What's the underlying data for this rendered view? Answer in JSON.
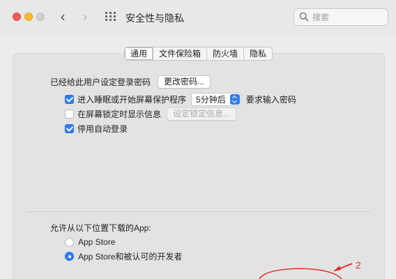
{
  "window": {
    "title": "安全性与隐私",
    "search_placeholder": "搜索"
  },
  "icons": {
    "back": "chevron-left-icon",
    "forward": "chevron-right-icon",
    "grid": "grid-icon",
    "search": "search-icon"
  },
  "tabs": [
    {
      "label": "通用",
      "active": true
    },
    {
      "label": "文件保险箱",
      "active": false
    },
    {
      "label": "防火墙",
      "active": false
    },
    {
      "label": "隐私",
      "active": false
    }
  ],
  "general": {
    "login_password_label": "已经给此用户设定登录密码",
    "change_password_button": "更改密码...",
    "require_password": {
      "checked": true,
      "label_before": "进入睡眠或开始屏幕保护程序",
      "delay_value": "5分钟后",
      "label_after": "要求输入密码"
    },
    "show_message": {
      "checked": false,
      "label": "在屏幕锁定时显示信息",
      "button": "设定锁定信息..."
    },
    "disable_auto_login": {
      "checked": true,
      "label": "停用自动登录"
    }
  },
  "downloads": {
    "heading": "允许从以下位置下载的App:",
    "options": [
      {
        "label": "App Store",
        "selected": false
      },
      {
        "label": "App Store和被认可的开发者",
        "selected": true
      }
    ]
  },
  "annotation": {
    "number": "2",
    "color": "#e0312b"
  },
  "colors": {
    "accent": "#2f7cf6",
    "close": "#fe5f57",
    "minimize": "#febc2e"
  }
}
